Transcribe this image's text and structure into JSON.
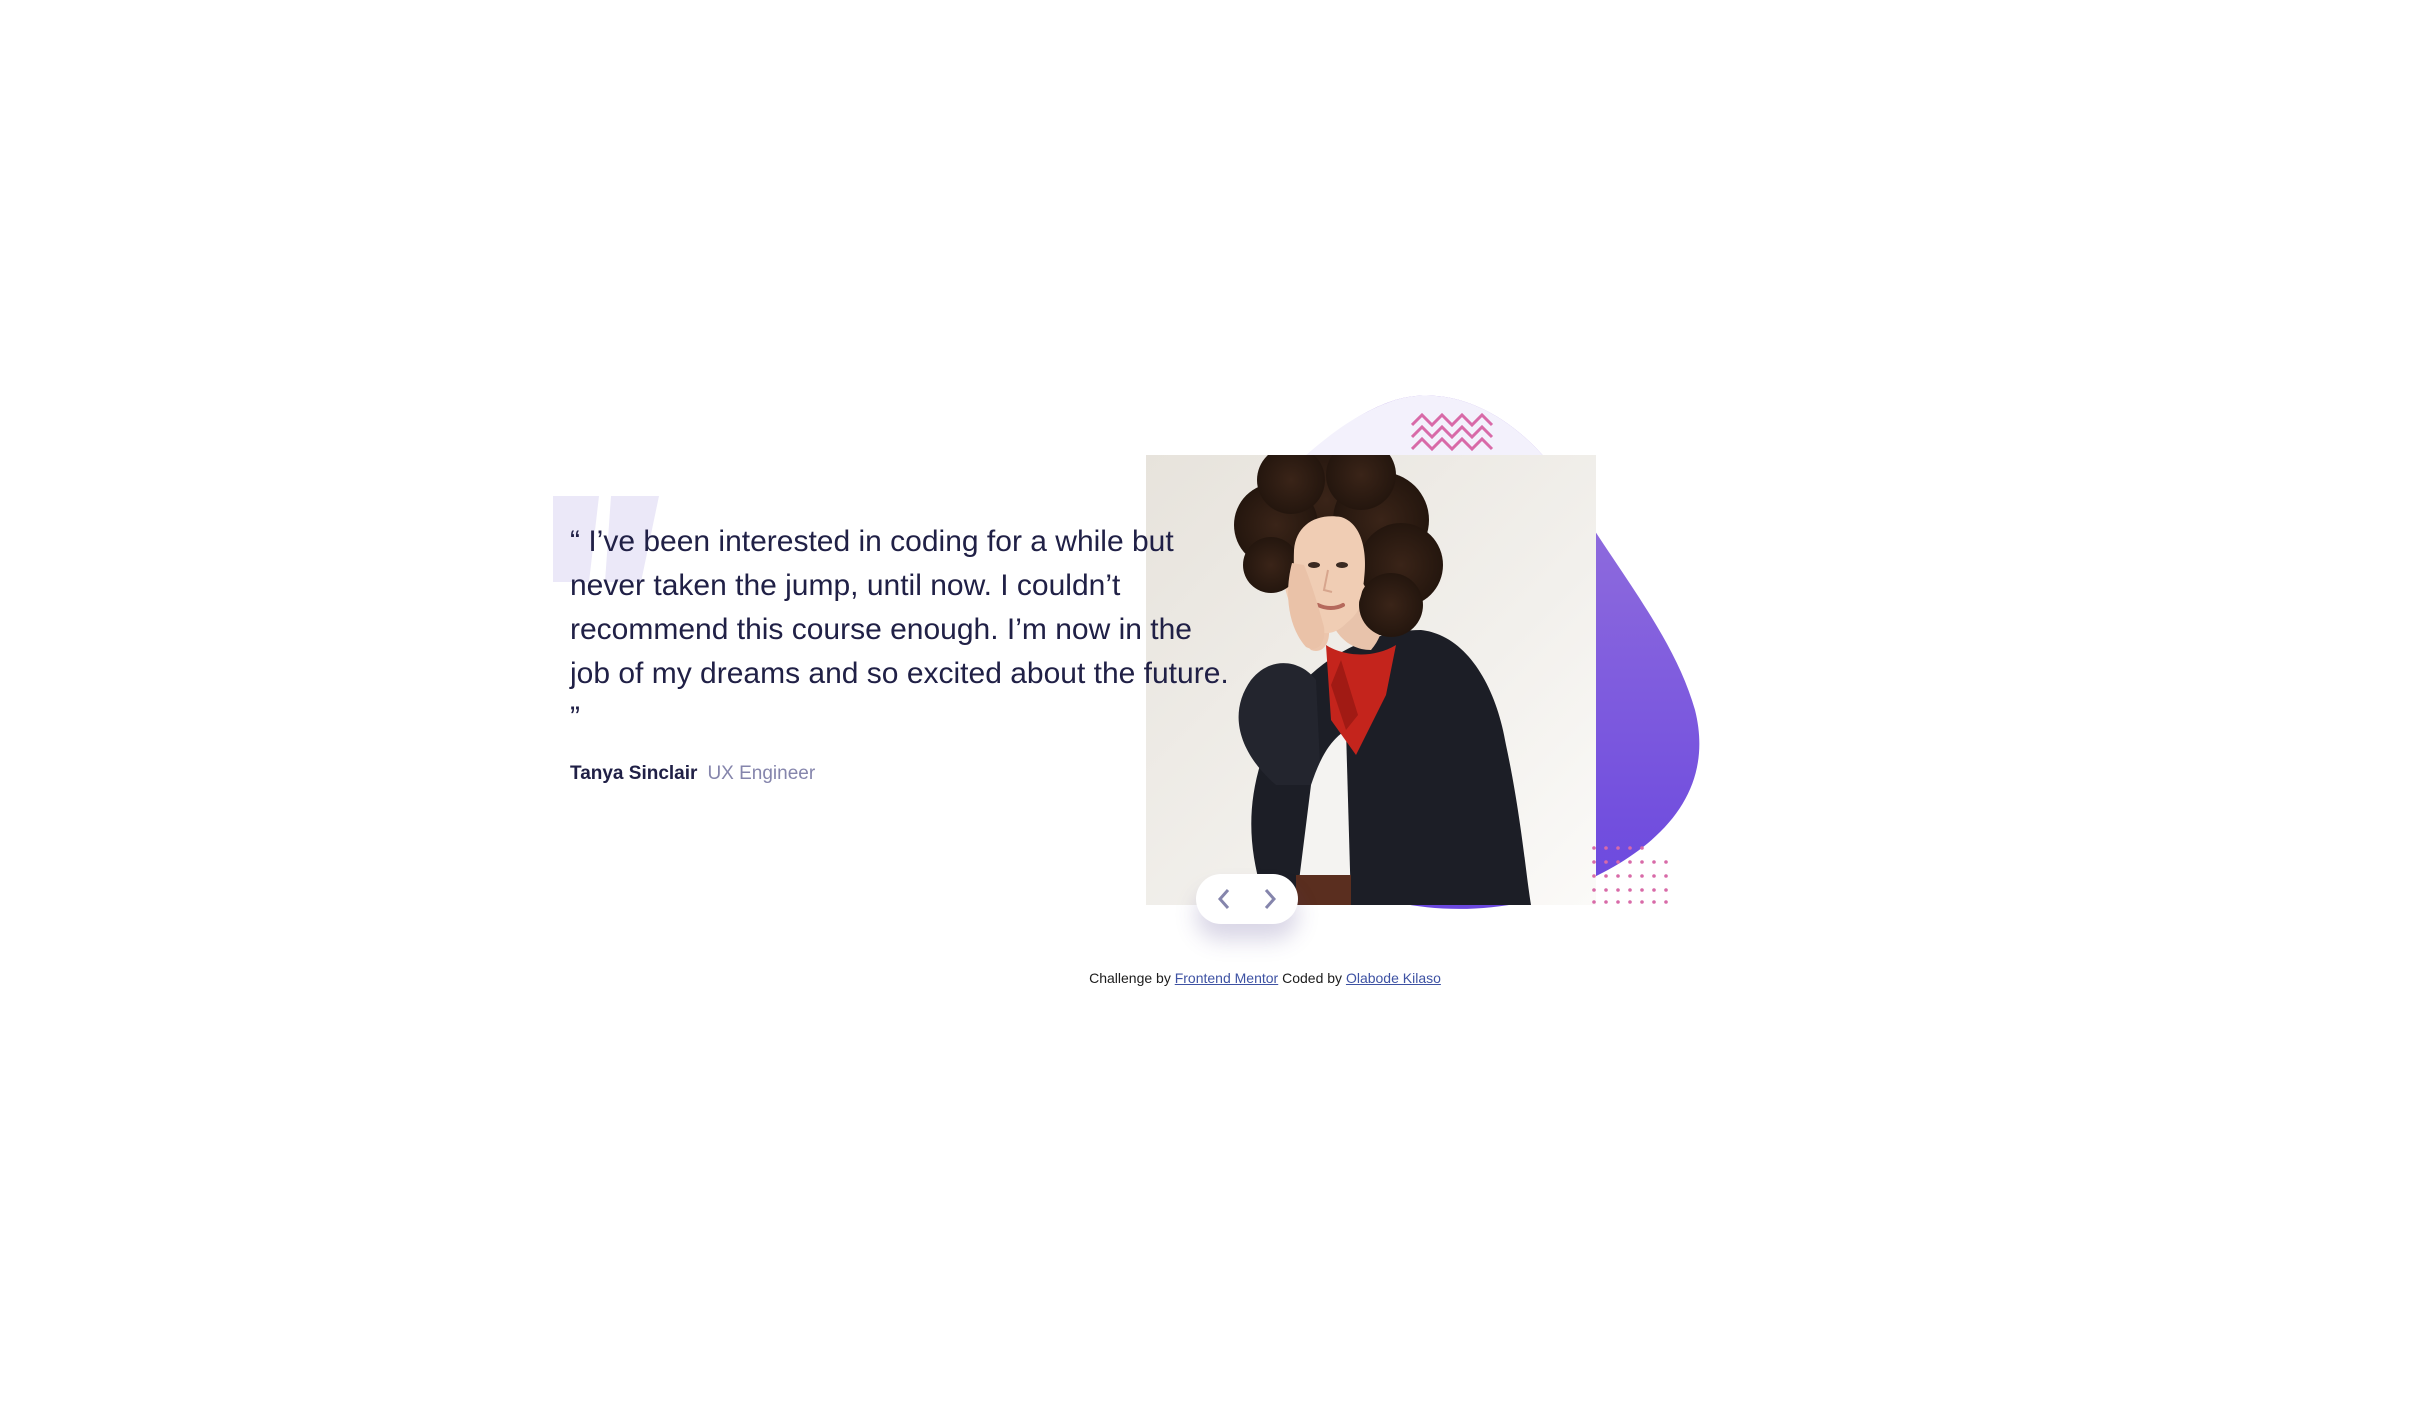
{
  "testimonial": {
    "quote": "“ I’ve been interested in coding for a while but never taken the jump, until now. I couldn’t recommend this course enough. I’m now in the job of my dreams and so excited about the future. ”",
    "author_name": "Tanya Sinclair",
    "author_role": "UX Engineer"
  },
  "photo": {
    "alt": "Tanya Sinclair"
  },
  "controls": {
    "prev_icon": "chevron-left-icon",
    "next_icon": "chevron-right-icon"
  },
  "attribution": {
    "prefix": "Challenge by",
    "challenge_link": "Frontend Mentor",
    "middle": "Coded by",
    "author_link": "Olabode Kilaso"
  },
  "colors": {
    "text_dark": "#202046",
    "text_muted": "#8585ac",
    "accent_purple": "#7a5ee0",
    "blob_light": "#f2f0fb",
    "quote_mark": "#eae7f8",
    "pattern_pink": "#d86aa8"
  }
}
